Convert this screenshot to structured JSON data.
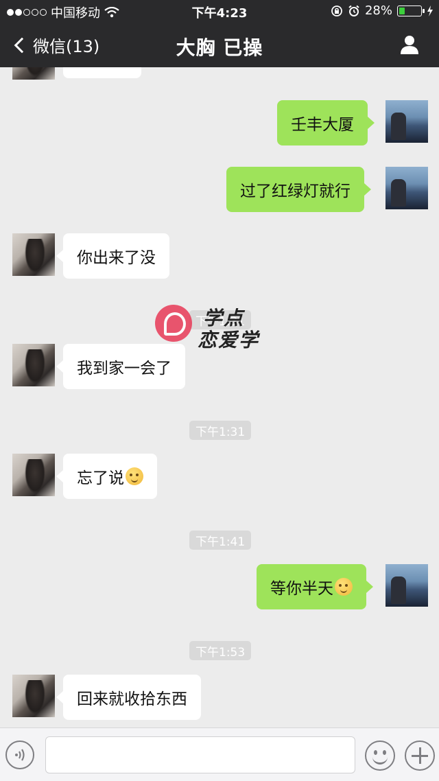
{
  "status_bar": {
    "carrier": "中国移动",
    "time": "下午4:23",
    "battery": "28%",
    "battery_level": 0.28
  },
  "nav": {
    "back_label": "微信(13)",
    "title": "大胸 已操"
  },
  "messages": [
    {
      "side": "right",
      "text": "壬丰大厦"
    },
    {
      "side": "right",
      "text": "过了红绿灯就行"
    },
    {
      "side": "left",
      "text": "你出来了没"
    },
    {
      "side": "left",
      "text": "我到家一会了"
    },
    {
      "side": "left",
      "text": "忘了说",
      "emoji": "awkward-smile-emoji"
    },
    {
      "side": "right",
      "text": "等你半天",
      "emoji": "crazy-face-emoji"
    },
    {
      "side": "left",
      "text": "回来就收拾东西"
    }
  ],
  "timestamps": [
    "下午1:31",
    "下午1:31",
    "下午1:41",
    "下午1:53"
  ],
  "watermark": {
    "line1": "学点",
    "line2": "恋爱学"
  },
  "icons": {
    "back": "chevron-left-icon",
    "contact": "person-icon",
    "voice": "voice-icon",
    "emoji": "emoji-face-icon",
    "more": "plus-icon"
  },
  "colors": {
    "header_bg": "#2a2a2c",
    "chat_bg": "#ececec",
    "sent_bubble": "#9ee35a",
    "received_bubble": "#ffffff",
    "battery_fill": "#3ccf3c"
  }
}
